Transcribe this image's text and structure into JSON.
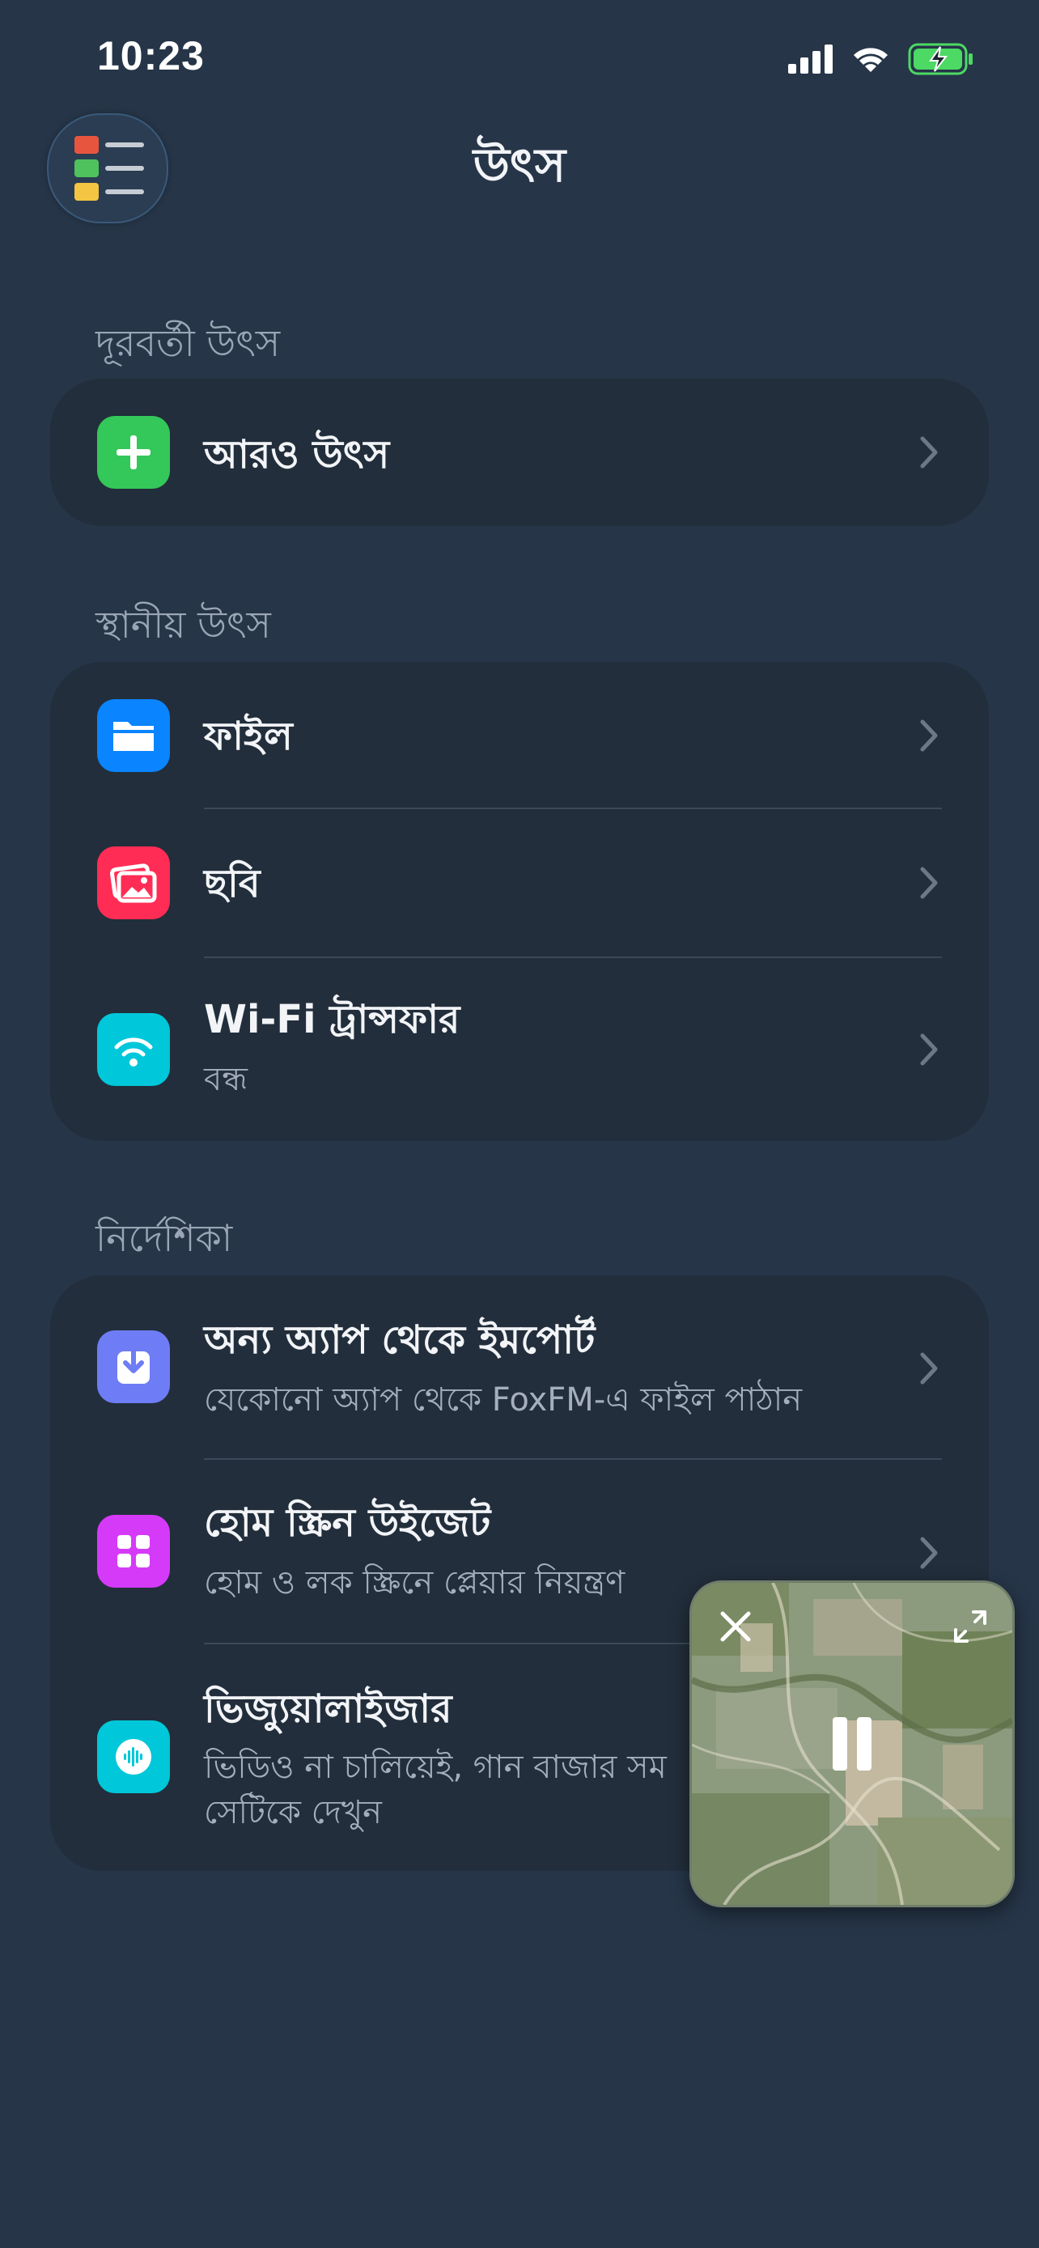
{
  "status_bar": {
    "time": "10:23"
  },
  "header": {
    "title": "উৎস"
  },
  "sections": {
    "remote": {
      "heading": "দূরবর্তী উৎস",
      "items": [
        {
          "label": "আরও উৎস",
          "icon": "plus-icon",
          "color": "#34c759"
        }
      ]
    },
    "local": {
      "heading": "স্থানীয় উৎস",
      "items": [
        {
          "label": "ফাইল",
          "icon": "folder-icon",
          "color": "#0a84ff"
        },
        {
          "label": "ছবি",
          "icon": "photos-icon",
          "color": "#ff2d55"
        },
        {
          "label": "Wi-Fi ট্রান্সফার",
          "subtitle": "বন্ধ",
          "icon": "wifi-icon",
          "color": "#00c7d9"
        }
      ]
    },
    "guide": {
      "heading": "নির্দেশিকা",
      "items": [
        {
          "label": "অন্য অ্যাপ থেকে ইমপোর্ট",
          "subtitle": "যেকোনো অ্যাপ থেকে FoxFM-এ ফাইল পাঠান",
          "icon": "import-icon",
          "color": "#6e7cf5"
        },
        {
          "label": "হোম স্ক্রিন উইজেট",
          "subtitle": "হোম ও লক স্ক্রিনে প্লেয়ার নিয়ন্ত্রণ",
          "icon": "widget-grid-icon",
          "color": "#d63af9"
        },
        {
          "label": "ভিজ্যুয়ালাইজার",
          "subtitle_line1": "ভিডিও না চালিয়েই, গান বাজার সম",
          "subtitle_line2": "সেটিকে দেখুন",
          "icon": "waveform-icon",
          "color": "#00c7d9"
        }
      ]
    }
  },
  "pip_player": {
    "state": "playing",
    "icons": [
      "close-icon",
      "expand-icon",
      "pause-icon"
    ]
  }
}
